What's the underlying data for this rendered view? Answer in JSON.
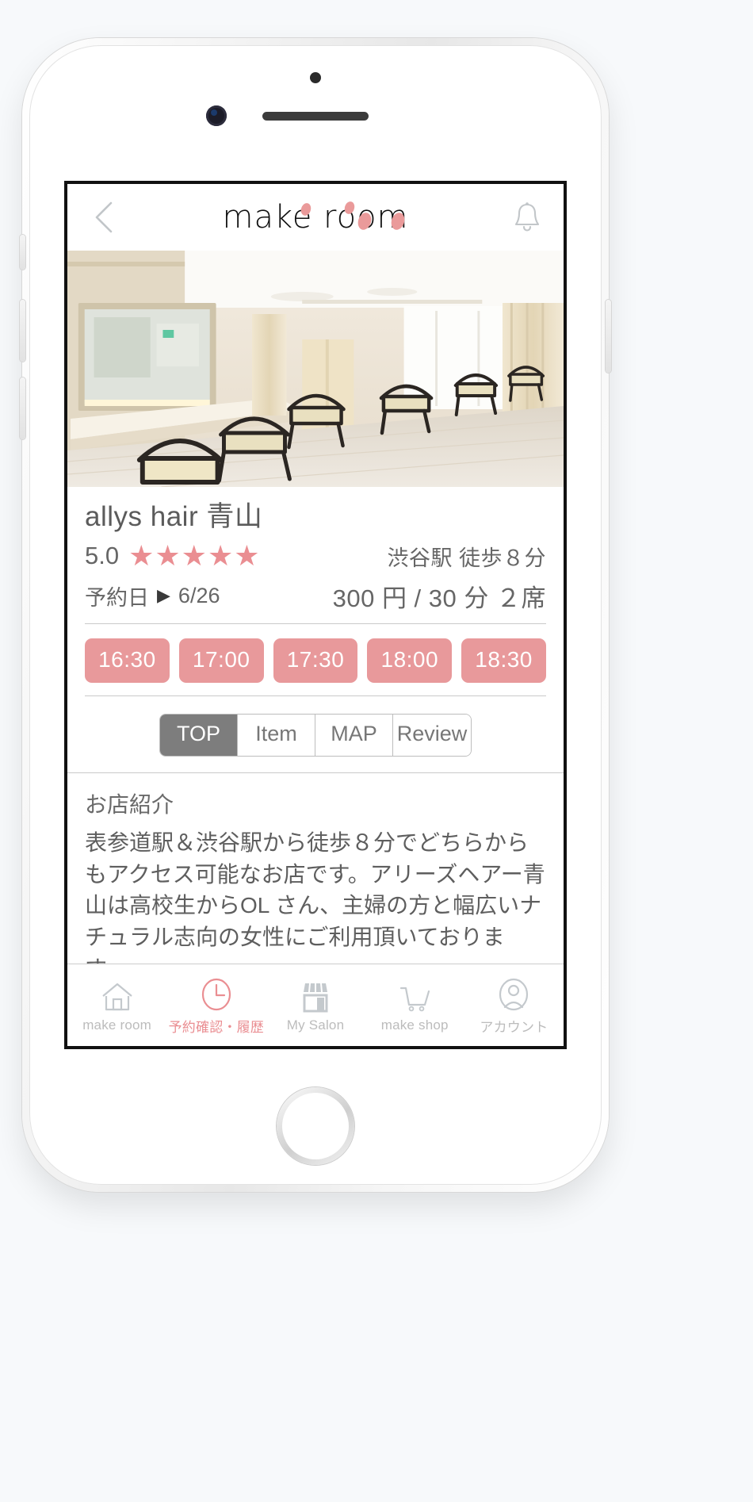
{
  "app": {
    "logo_text": "make room",
    "brand_pink": "#e8999b",
    "back_icon": "chevron-left-icon",
    "bell_icon": "bell-icon"
  },
  "salon": {
    "name": "allys hair 青山",
    "rating_value": "5.0",
    "stars": [
      "★",
      "★",
      "★",
      "★",
      "★"
    ],
    "access": "渋谷駅 徒歩８分",
    "reservation_label": "予約日",
    "reservation_marker": "▶",
    "reservation_date": "6/26",
    "price": "300 円 / 30 分 ２席"
  },
  "time_slots": [
    {
      "label": "16:30"
    },
    {
      "label": "17:00"
    },
    {
      "label": "17:30"
    },
    {
      "label": "18:00"
    },
    {
      "label": "18:30"
    }
  ],
  "tabs": [
    {
      "label": "TOP",
      "active": true
    },
    {
      "label": "Item",
      "active": false
    },
    {
      "label": "MAP",
      "active": false
    },
    {
      "label": "Review",
      "active": false
    }
  ],
  "description": {
    "title": "お店紹介",
    "body": "表参道駅＆渋谷駅から徒歩８分でどちらからもアクセス可能なお店です。アリーズヘアー青山は高校生からOL さん、主婦の方と幅広いナチュラル志向の女性にご利用頂いております。"
  },
  "bottom_nav": [
    {
      "label": "make room",
      "icon": "home-icon",
      "active": false
    },
    {
      "label": "予約確認・履歴",
      "icon": "clock-icon",
      "active": true
    },
    {
      "label": "My Salon",
      "icon": "storefront-icon",
      "active": false
    },
    {
      "label": "make shop",
      "icon": "shopping-cart-icon",
      "active": false
    },
    {
      "label": "アカウント",
      "icon": "account-circle-icon",
      "active": false
    }
  ]
}
